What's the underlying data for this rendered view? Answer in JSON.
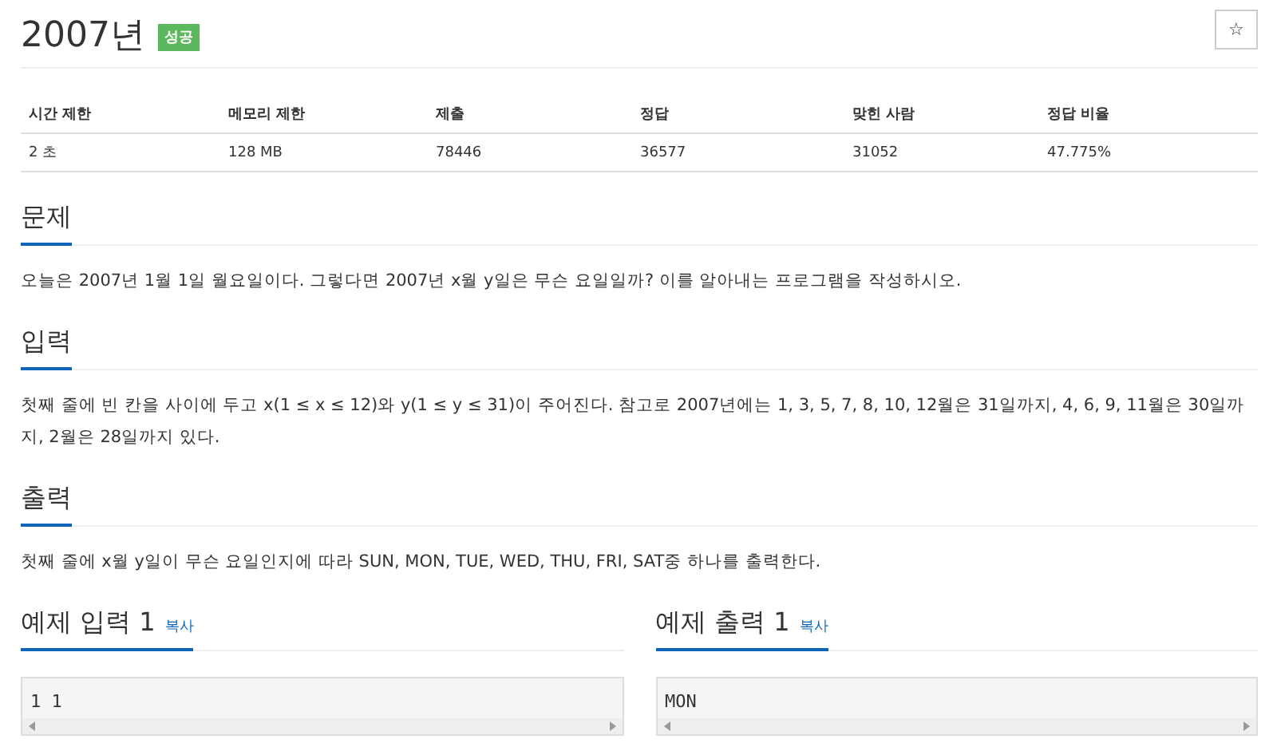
{
  "title": "2007년",
  "badge": "성공",
  "star_button": "☆",
  "stats": {
    "columns": [
      "시간 제한",
      "메모리 제한",
      "제출",
      "정답",
      "맞힌 사람",
      "정답 비율"
    ],
    "rows": [
      [
        "2 초",
        "128 MB",
        "78446",
        "36577",
        "31052",
        "47.775%"
      ]
    ]
  },
  "sections": [
    {
      "heading": "문제",
      "text": "오늘은 2007년 1월 1일 월요일이다. 그렇다면 2007년 x월 y일은 무슨 요일일까? 이를 알아내는 프로그램을 작성하시오."
    },
    {
      "heading": "입력",
      "text": "첫째 줄에 빈 칸을 사이에 두고 x(1 ≤ x ≤ 12)와 y(1 ≤ y ≤ 31)이 주어진다. 참고로 2007년에는 1, 3, 5, 7, 8, 10, 12월은 31일까지, 4, 6, 9, 11월은 30일까지, 2월은 28일까지 있다."
    },
    {
      "heading": "출력",
      "text": "첫째 줄에 x월 y일이 무슨 요일인지에 따라 SUN, MON, TUE, WED, THU, FRI, SAT중 하나를 출력한다."
    }
  ],
  "samples": [
    {
      "heading": "예제 입력 1",
      "copy": "복사",
      "code": "1 1"
    },
    {
      "heading": "예제 출력 1",
      "copy": "복사",
      "code": "MON"
    }
  ]
}
